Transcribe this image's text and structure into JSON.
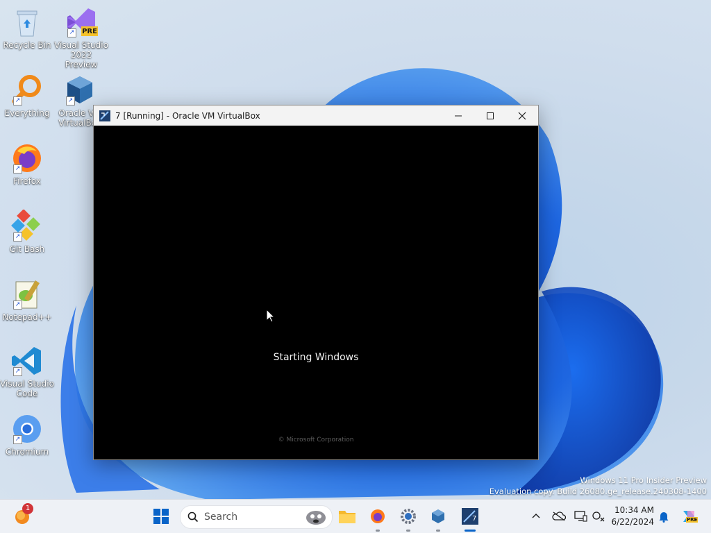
{
  "desktop": {
    "icons": [
      {
        "label": "Recycle Bin"
      },
      {
        "label": "Visual Studio 2022 Preview",
        "badge": "PRE"
      },
      {
        "label": "Everything"
      },
      {
        "label": "Oracle VM VirtualBox"
      },
      {
        "label": "Firefox"
      },
      {
        "label": "Git Bash"
      },
      {
        "label": "Notepad++"
      },
      {
        "label": "Visual Studio Code"
      },
      {
        "label": "Chromium"
      }
    ]
  },
  "window": {
    "title": "7 [Running] - Oracle VM VirtualBox",
    "vm": {
      "status_text": "Starting Windows",
      "copyright": "© Microsoft Corporation"
    }
  },
  "watermark": {
    "line1": "Windows 11 Pro Insider Preview",
    "line2": "Evaluation copy. Build 26080.ge_release.240308-1400"
  },
  "taskbar": {
    "widgets_badge": "1",
    "search_placeholder": "Search",
    "clock_time": "10:34 AM",
    "clock_date": "6/22/2024",
    "copilot_badge": "PRE",
    "vbox_badge": "7"
  },
  "colors": {
    "accent": "#0a64c8",
    "titlebar": "#f3f3f3",
    "vm_background": "#000000",
    "taskbar": "#eef1f6"
  }
}
